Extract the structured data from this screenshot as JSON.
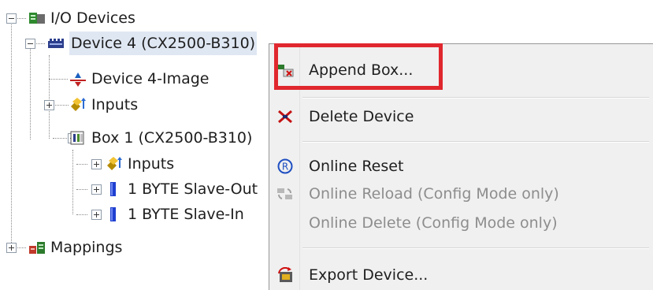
{
  "tree": {
    "items": [
      {
        "label": "I/O Devices",
        "icon": "io-devices-icon"
      },
      {
        "label": "Device 4 (CX2500-B310)",
        "icon": "device-ethercat-icon"
      },
      {
        "label": "Device 4-Image",
        "icon": "device-image-icon"
      },
      {
        "label": "Inputs",
        "icon": "inputs-icon"
      },
      {
        "label": "Box 1 (CX2500-B310)",
        "icon": "box-icon"
      },
      {
        "label": "Inputs",
        "icon": "inputs-icon"
      },
      {
        "label": "1 BYTE Slave-Out",
        "icon": "slave-byte-icon"
      },
      {
        "label": "1 BYTE Slave-In",
        "icon": "slave-byte-icon"
      },
      {
        "label": "Mappings",
        "icon": "mappings-icon"
      }
    ]
  },
  "context_menu": {
    "items": [
      {
        "label": "Append Box...",
        "icon": "append-box-icon",
        "enabled": true
      },
      {
        "label": "Delete Device",
        "icon": "delete-icon",
        "enabled": true
      },
      {
        "label": "Online Reset",
        "icon": "reset-icon",
        "enabled": true
      },
      {
        "label": "Online Reload (Config Mode only)",
        "icon": "reload-icon",
        "enabled": false
      },
      {
        "label": "Online Delete (Config Mode only)",
        "icon": "",
        "enabled": false
      },
      {
        "label": "Export Device...",
        "icon": "export-icon",
        "enabled": true
      }
    ]
  },
  "colors": {
    "highlight": "#e0272e",
    "selection": "#dfe7f3"
  }
}
